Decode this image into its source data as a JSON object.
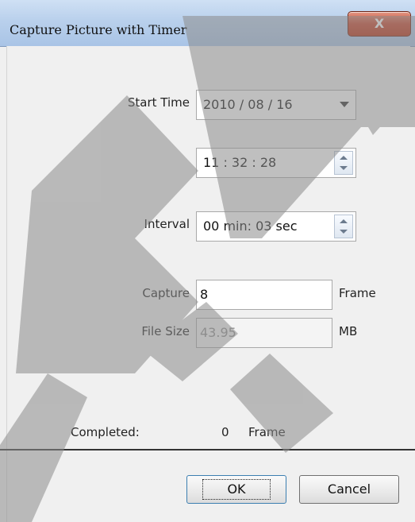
{
  "window": {
    "title": "Capture Picture with Timer",
    "close_label": "X"
  },
  "form": {
    "start_time_label": "Start Time",
    "date_value": "2010 / 08 / 16",
    "time_value": "11 : 32 : 28",
    "interval_label": "Interval",
    "interval_value": "00 min: 03 sec",
    "capture_label": "Capture",
    "capture_value": "8",
    "capture_unit": "Frame",
    "file_size_label": "File Size",
    "file_size_value": "43.95",
    "file_size_unit": "MB",
    "completed_label": "Completed:",
    "completed_value": "0",
    "completed_unit": "Frame"
  },
  "buttons": {
    "ok": "OK",
    "cancel": "Cancel"
  }
}
